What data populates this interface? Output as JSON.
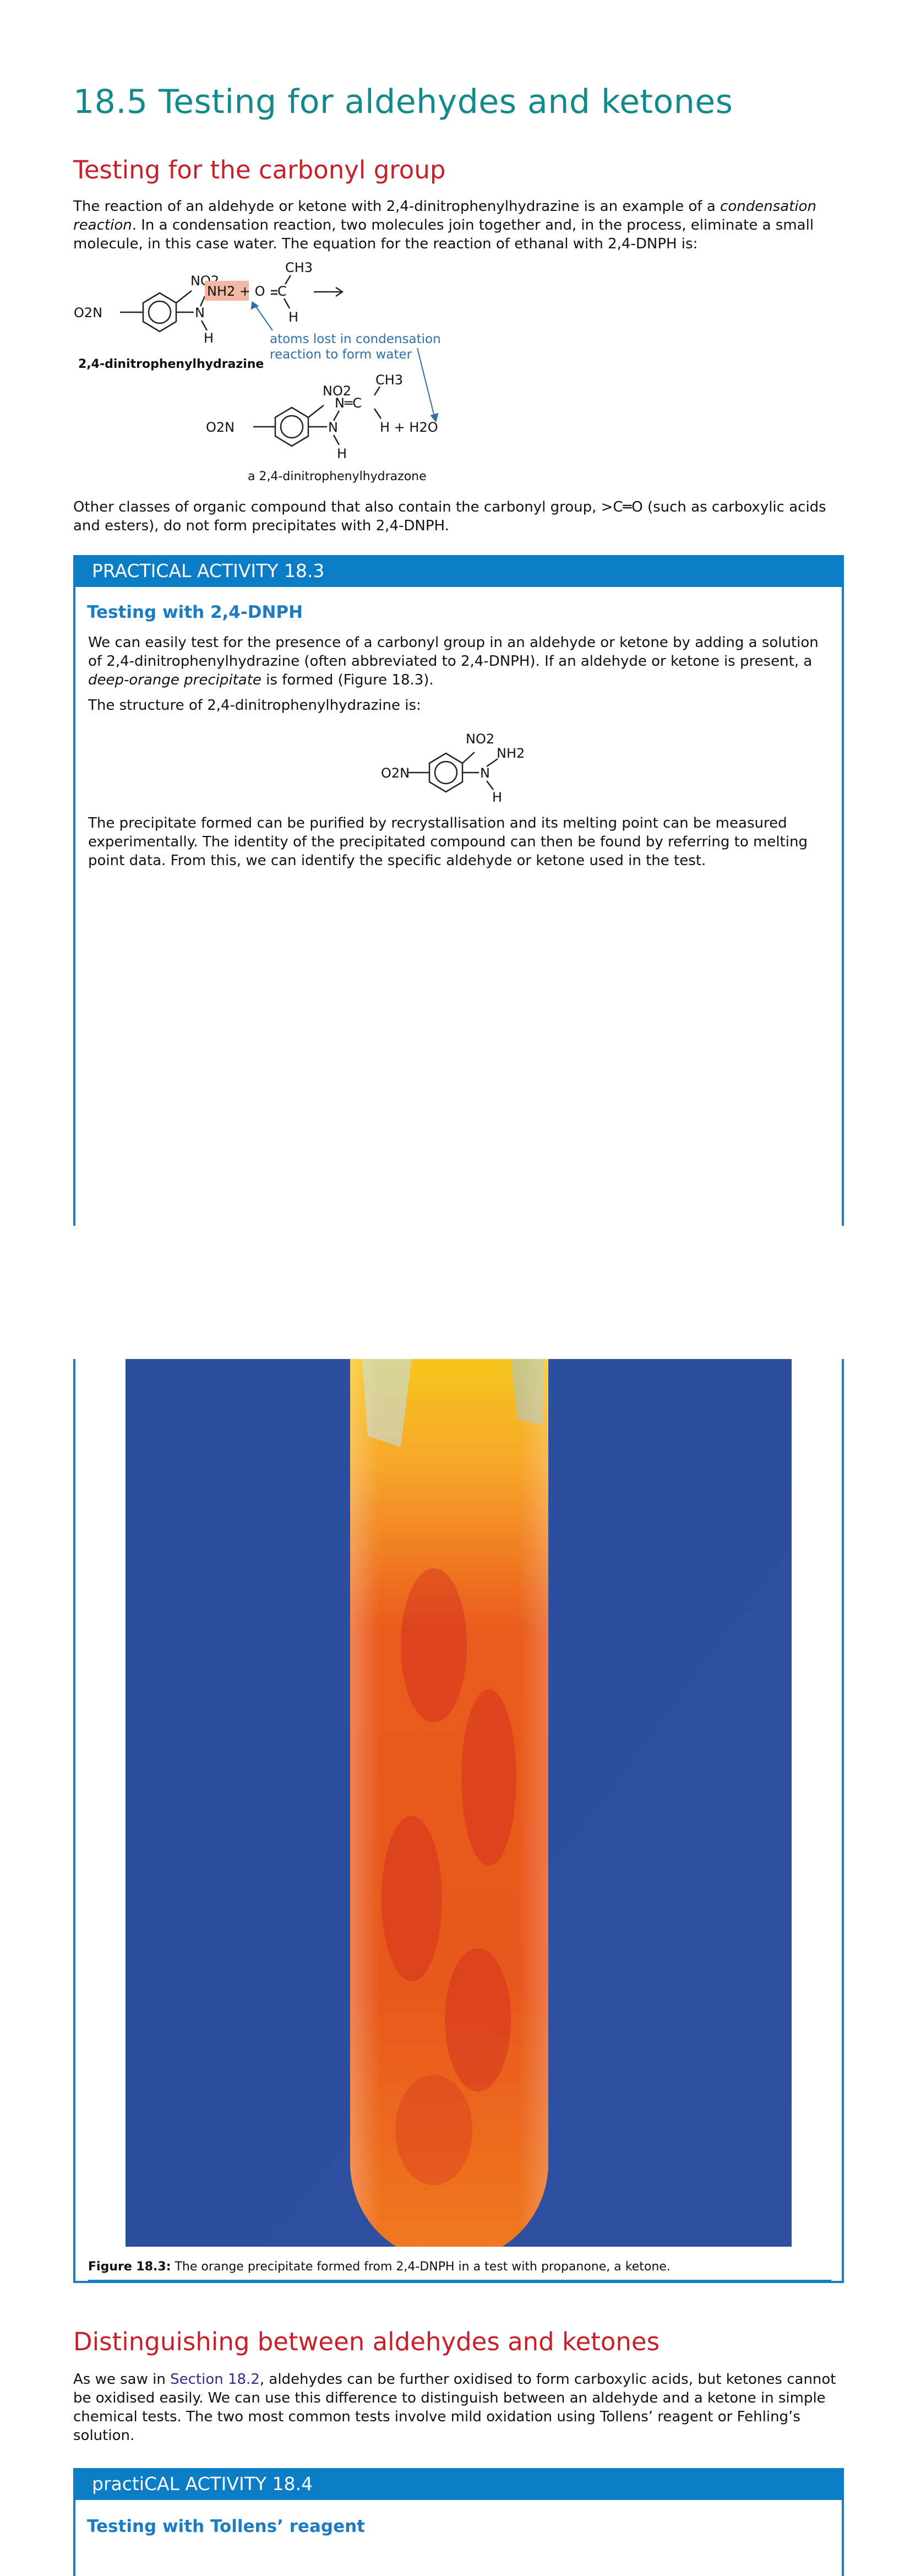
{
  "section_title": "18.5 Testing for aldehydes and ketones",
  "carbonyl": {
    "heading": "Testing for the carbonyl group",
    "para1_a": "The reaction of an aldehyde or ketone with 2,4-dinitrophenylhydrazine is an example of a ",
    "para1_em": "condensation reaction",
    "para1_b": ". In a condensation reaction, two molecules join together and, in the process, eliminate a small molecule, in this case water. The equation for the reaction of ethanal with 2,4-DNPH is:",
    "para2": "Other classes of organic compound that also contain the carbonyl group, >C═O (such as carboxylic acids and esters), do not form precipitates with 2,4-DNPH."
  },
  "reaction_diagram": {
    "no2": "NO2",
    "o2n": "O2N",
    "nh2_o": "NH2 + O",
    "c": "C",
    "ch3": "CH3",
    "n": "N",
    "h": "H",
    "reactant_label": "2,4-dinitrophenylhydrazine",
    "annotation_line1": "atoms lost in condensation",
    "annotation_line2": "reaction to form water",
    "product_nc": "N═C",
    "plus_water": "H  +  H2O",
    "product_label": "a 2,4-dinitrophenylhydrazone",
    "highlight_color": "#f3b8a4",
    "annotation_color": "#2e6fa8"
  },
  "activity_18_3": {
    "header": "PRACTICAL ACTIVITY 18.3",
    "title": "Testing with 2,4-DNPH",
    "p1_a": "We can easily test for the presence of a carbonyl group in an aldehyde or ketone by adding a solution of 2,4-dinitrophenylhydrazine (often abbreviated to 2,4-DNPH). If an aldehyde or ketone is present, a ",
    "p1_em": "deep-orange precipitate",
    "p1_b": " is formed (Figure 18.3).",
    "p2": "The structure of 2,4-dinitrophenylhydrazine is:",
    "p3": "The precipitate formed can be purified by recrystallisation and its melting point can be measured experimentally. The identity of the precipitated compound can then be found by referring to melting point data. From this, we can identify the specific aldehyde or ketone used in the test.",
    "structure": {
      "no2": "NO2",
      "o2n": "O2N",
      "n": "N",
      "nh2": "NH2",
      "h": "H"
    },
    "figure_label": "Figure 18.3:",
    "figure_caption": " The orange precipitate formed from 2,4-DNPH in a test with propanone, a ketone."
  },
  "distinguishing": {
    "heading": "Distinguishing between aldehydes and ketones",
    "p_a": "As we saw in ",
    "p_link": "Section 18.2",
    "p_b": ", aldehydes can be further oxidised to form carboxylic acids, but ketones cannot be oxidised easily. We can use this difference to distinguish between an aldehyde and a ketone in simple chemical tests. The two most common tests involve mild oxidation using Tollens’ reagent or Fehling’s solution."
  },
  "activity_18_4": {
    "header": "practiCAL ACTIVITY 18.4",
    "title": "Testing with Tollens’ reagent"
  },
  "colors": {
    "section_title": "#12898b",
    "heading_red": "#c8202a",
    "box_blue": "#0b7dc6",
    "photo_background": "#2e4f9e",
    "precipitate": "#e8581c"
  }
}
